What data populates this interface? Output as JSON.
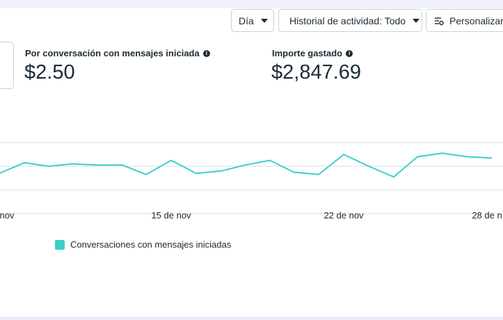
{
  "toolbar": {
    "day_label": "Día",
    "history_label": "Historial de actividad: Todo",
    "customize_label": "Personalizar"
  },
  "metrics": [
    {
      "label": "Por conversación con mensajes iniciada",
      "value": "$2.50"
    },
    {
      "label": "Importe gastado",
      "value": "$2,847.69"
    }
  ],
  "colors": {
    "series": "#3ccfc9",
    "grid": "#d8dce3",
    "info_icon": "#1c2b33"
  },
  "icons": {
    "info": "info-icon",
    "customize": "settings-sliders-icon",
    "dropdown": "caret-down-icon"
  },
  "chart_data": {
    "type": "line",
    "x_tick_labels": [
      "nov",
      "15 de nov",
      "22 de nov",
      "28 de n"
    ],
    "grid": true,
    "legend": "bottom-left",
    "series": [
      {
        "name": "Conversaciones con mensajes iniciadas",
        "values": [
          54,
          63,
          60,
          62,
          61,
          61,
          53,
          65,
          54,
          56,
          61,
          65,
          55,
          53,
          70,
          60,
          51,
          68,
          71,
          68,
          67
        ]
      }
    ],
    "ylim": [
      20,
      80
    ]
  }
}
